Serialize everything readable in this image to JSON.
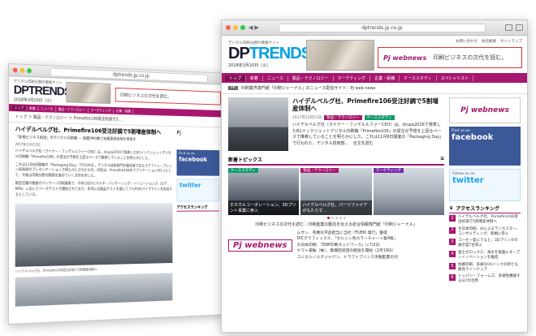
{
  "back": {
    "url": "dptrends.jp.co.jp",
    "tagline": "デジタル印刷分野の情報サイト",
    "logo": "DPTRENDS",
    "date": "2018年3月20日（火）",
    "banner_text": "印刷ビジネスの次代を読む。",
    "menu": [
      "トップ",
      "新着",
      "ニュース",
      "製品・テクノロジー",
      "マーケティング",
      "企業・組織",
      "ケーススタディ",
      "スペシャリスト"
    ],
    "breadcrumb": "トップ ＞ 製品・テクノロジー ＞ Primefire106受注好調で5…",
    "title": "ハイデルベルグ社、Primefire106受注好調で5割増産体制へ",
    "subtitle": "「新規ビジネス創出」のデジタル印刷機 ― 旗艦PMS機で実績事例実現を目指す",
    "date_line": "2017年11月13日",
    "para1": "ハイデルベルグ社（ライナー・フンデルルファーCEO）は、drupa2016で発表したB1インクジェットデジタル印刷機「Primefire106」の受注が予想を上回るペースで推移していることを明らかにした。",
    "para2": "これは11月8日開催の「Packaging Day」で行われた、デジタル技術部門の責任者であるステファン・プレシン技術部のプレゼンテーションで明らかにされたもの。同社は、Primefire106のアプリケーションの1つとして、今後は印刷分野の開発を進めていく方針を示した。",
    "para3": "製造営業の数値がパッケージ印刷業者で、今年1月からマルチ・パッケージング・ソリューションズ（以下MPS）においてベータテストが開始されており、年内には製品テストを通じてフルPVのパイプラインを形成するとしている。",
    "caption": "ハイデルベルグ社、Primefire106受注好調で5割増産体制へ",
    "side_fb_small": "Find us on",
    "side_fb": "facebook",
    "side_tw": "twitter",
    "side_rank": "アクセスランキング"
  },
  "front": {
    "url": "dptrends.jp.co.jp",
    "tagline": "デジタル印刷分野の情報サイト",
    "logo_a": "DP",
    "logo_b": "TRENDS",
    "date": "2018年3月20日（火）",
    "topnav": [
      "お問い合わせ",
      "会社概要",
      "サイトマップ"
    ],
    "banner_text": "印刷ビジネスの次代を読む。",
    "banner_brand": "Pj webnews",
    "menu": [
      "トップ",
      "新着",
      "ニュース",
      "製品・テクノロジー",
      "マーケティング",
      "企業・組織",
      "ケーススタディ",
      "スペシャリスト"
    ],
    "sub_badge": "PR",
    "sub_text": "印刷業界専門紙「印刷ジャーナル」のニュース配信サイト：PJ web news",
    "article_title": "ハイデルベルグ社、Primefire106受注好調で5割増産体制へ",
    "article_date": "2017年11月13日",
    "article_tag1": "製品・テクノロジー",
    "article_tag2": "ケーススタディ",
    "article_body": "ハイデルベルグ社（ライナー・フンデルルファーCEO）は、drupa2016で発表したB1インクジェットデジタル印刷機「Primefire106」の受注が予想を上回るペースで推移していることを明らかにした。これは11月8日開催の「Packaging Day」で行われた、デジタル技術部…　全文を読む",
    "section_title": "新着トピックス",
    "tiles": [
      {
        "tag": "ケーススタディ",
        "caption": "ホネカルコーポレーション、3Dプリント事業に参入"
      },
      {
        "tag": "製品・テクノロジー",
        "caption": "ハイデルベルグ社、パーツファイアがもたらす…"
      },
      {
        "tag": "マーケティング",
        "caption": ""
      }
    ],
    "links": [
      "印刷ビジネスの次代を読む｜印刷産業の動向を伝える総合情報専門紙「印刷ジャーナル」"
    ],
    "pj_logo": "Pj webnews",
    "news": [
      "ムサシ、有機化学品担当に当社「FUEKI 発行」獲得",
      "DICグラフィックス、「セルシン色カラーチャート第4版」",
      "大日本印刷、「DNP印刷ネットワーク」に7/2日",
      "ヤマト運輸（株）、無償回収回の配送を開始（2月19日）",
      "コニカミノルタジャパン、ドラフトプリンス手動配置の刊",
      "デジタル製作 中ロットの印刷が「パッケージ印刷サービス」開始"
    ],
    "side_ad": "Pj webnews",
    "fb_small": "Find us on",
    "fb": "facebook",
    "tw_small": "Follow us on",
    "tw": "twitter",
    "rank_title": "アクセスランキング",
    "ranking": [
      "ハイデルベルグ社、Primefire106受注好調で5割増産体制へ",
      "大日本印刷、AIによるランカスター、コンサルティング、新規に参入",
      "コーセー型にでると、3Dプリンタの展示型7台導入",
      "富士ゼロックス、海水を基盤にオープンイノベーションを推進",
      "佐藤印刷、多様なUVインクの新たな販売ラインナップ",
      "トッパン・フォームズ、多様性機能するIoTの活用",
      "2016年印刷業のネット媒体の状況の調査結果"
    ]
  }
}
